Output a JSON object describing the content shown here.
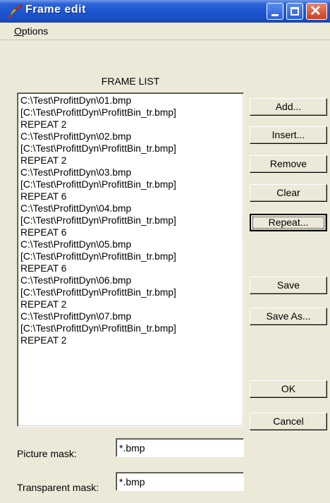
{
  "window": {
    "title": "Frame edit"
  },
  "menu": {
    "options_label": "Options"
  },
  "frame_list": {
    "title": "FRAME LIST",
    "items": [
      "C:\\Test\\ProfittDyn\\01.bmp",
      "[C:\\Test\\ProfittDyn\\ProfittBin_tr.bmp]",
      "REPEAT 2",
      "C:\\Test\\ProfittDyn\\02.bmp",
      "[C:\\Test\\ProfittDyn\\ProfittBin_tr.bmp]",
      "REPEAT 2",
      "C:\\Test\\ProfittDyn\\03.bmp",
      "[C:\\Test\\ProfittDyn\\ProfittBin_tr.bmp]",
      "REPEAT 6",
      "C:\\Test\\ProfittDyn\\04.bmp",
      "[C:\\Test\\ProfittDyn\\ProfittBin_tr.bmp]",
      "REPEAT 6",
      "C:\\Test\\ProfittDyn\\05.bmp",
      "[C:\\Test\\ProfittDyn\\ProfittBin_tr.bmp]",
      "REPEAT 6",
      "C:\\Test\\ProfittDyn\\06.bmp",
      "[C:\\Test\\ProfittDyn\\ProfittBin_tr.bmp]",
      "REPEAT 2",
      "C:\\Test\\ProfittDyn\\07.bmp",
      "[C:\\Test\\ProfittDyn\\ProfittBin_tr.bmp]",
      "REPEAT 2"
    ]
  },
  "buttons": {
    "add": "Add...",
    "insert": "Insert...",
    "remove": "Remove",
    "clear": "Clear",
    "repeat": "Repeat...",
    "save": "Save",
    "save_as": "Save As...",
    "ok": "OK",
    "cancel": "Cancel"
  },
  "fields": {
    "picture_mask_label": "Picture mask:",
    "picture_mask_value": "*.bmp",
    "transparent_mask_label": "Transparent mask:",
    "transparent_mask_value": "*.bmp"
  },
  "icons": {
    "app": "pen-icon",
    "minimize": "minimize-icon",
    "maximize": "maximize-icon",
    "close": "close-icon"
  },
  "colors": {
    "titlebar": "#1d55d0",
    "close_button": "#c8411f",
    "dialog_background": "#ece9d8"
  }
}
